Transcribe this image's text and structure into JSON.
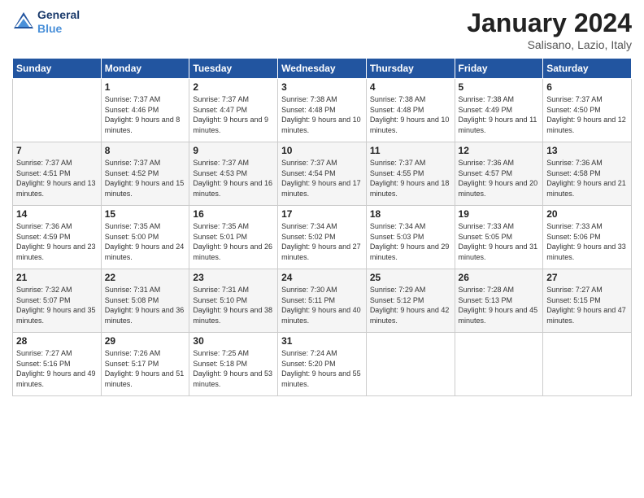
{
  "header": {
    "logo_line1": "General",
    "logo_line2": "Blue",
    "title": "January 2024",
    "subtitle": "Salisano, Lazio, Italy"
  },
  "days_of_week": [
    "Sunday",
    "Monday",
    "Tuesday",
    "Wednesday",
    "Thursday",
    "Friday",
    "Saturday"
  ],
  "weeks": [
    [
      {
        "day": "",
        "sunrise": "",
        "sunset": "",
        "daylight": ""
      },
      {
        "day": "1",
        "sunrise": "Sunrise: 7:37 AM",
        "sunset": "Sunset: 4:46 PM",
        "daylight": "Daylight: 9 hours and 8 minutes."
      },
      {
        "day": "2",
        "sunrise": "Sunrise: 7:37 AM",
        "sunset": "Sunset: 4:47 PM",
        "daylight": "Daylight: 9 hours and 9 minutes."
      },
      {
        "day": "3",
        "sunrise": "Sunrise: 7:38 AM",
        "sunset": "Sunset: 4:48 PM",
        "daylight": "Daylight: 9 hours and 10 minutes."
      },
      {
        "day": "4",
        "sunrise": "Sunrise: 7:38 AM",
        "sunset": "Sunset: 4:48 PM",
        "daylight": "Daylight: 9 hours and 10 minutes."
      },
      {
        "day": "5",
        "sunrise": "Sunrise: 7:38 AM",
        "sunset": "Sunset: 4:49 PM",
        "daylight": "Daylight: 9 hours and 11 minutes."
      },
      {
        "day": "6",
        "sunrise": "Sunrise: 7:37 AM",
        "sunset": "Sunset: 4:50 PM",
        "daylight": "Daylight: 9 hours and 12 minutes."
      }
    ],
    [
      {
        "day": "7",
        "sunrise": "Sunrise: 7:37 AM",
        "sunset": "Sunset: 4:51 PM",
        "daylight": "Daylight: 9 hours and 13 minutes."
      },
      {
        "day": "8",
        "sunrise": "Sunrise: 7:37 AM",
        "sunset": "Sunset: 4:52 PM",
        "daylight": "Daylight: 9 hours and 15 minutes."
      },
      {
        "day": "9",
        "sunrise": "Sunrise: 7:37 AM",
        "sunset": "Sunset: 4:53 PM",
        "daylight": "Daylight: 9 hours and 16 minutes."
      },
      {
        "day": "10",
        "sunrise": "Sunrise: 7:37 AM",
        "sunset": "Sunset: 4:54 PM",
        "daylight": "Daylight: 9 hours and 17 minutes."
      },
      {
        "day": "11",
        "sunrise": "Sunrise: 7:37 AM",
        "sunset": "Sunset: 4:55 PM",
        "daylight": "Daylight: 9 hours and 18 minutes."
      },
      {
        "day": "12",
        "sunrise": "Sunrise: 7:36 AM",
        "sunset": "Sunset: 4:57 PM",
        "daylight": "Daylight: 9 hours and 20 minutes."
      },
      {
        "day": "13",
        "sunrise": "Sunrise: 7:36 AM",
        "sunset": "Sunset: 4:58 PM",
        "daylight": "Daylight: 9 hours and 21 minutes."
      }
    ],
    [
      {
        "day": "14",
        "sunrise": "Sunrise: 7:36 AM",
        "sunset": "Sunset: 4:59 PM",
        "daylight": "Daylight: 9 hours and 23 minutes."
      },
      {
        "day": "15",
        "sunrise": "Sunrise: 7:35 AM",
        "sunset": "Sunset: 5:00 PM",
        "daylight": "Daylight: 9 hours and 24 minutes."
      },
      {
        "day": "16",
        "sunrise": "Sunrise: 7:35 AM",
        "sunset": "Sunset: 5:01 PM",
        "daylight": "Daylight: 9 hours and 26 minutes."
      },
      {
        "day": "17",
        "sunrise": "Sunrise: 7:34 AM",
        "sunset": "Sunset: 5:02 PM",
        "daylight": "Daylight: 9 hours and 27 minutes."
      },
      {
        "day": "18",
        "sunrise": "Sunrise: 7:34 AM",
        "sunset": "Sunset: 5:03 PM",
        "daylight": "Daylight: 9 hours and 29 minutes."
      },
      {
        "day": "19",
        "sunrise": "Sunrise: 7:33 AM",
        "sunset": "Sunset: 5:05 PM",
        "daylight": "Daylight: 9 hours and 31 minutes."
      },
      {
        "day": "20",
        "sunrise": "Sunrise: 7:33 AM",
        "sunset": "Sunset: 5:06 PM",
        "daylight": "Daylight: 9 hours and 33 minutes."
      }
    ],
    [
      {
        "day": "21",
        "sunrise": "Sunrise: 7:32 AM",
        "sunset": "Sunset: 5:07 PM",
        "daylight": "Daylight: 9 hours and 35 minutes."
      },
      {
        "day": "22",
        "sunrise": "Sunrise: 7:31 AM",
        "sunset": "Sunset: 5:08 PM",
        "daylight": "Daylight: 9 hours and 36 minutes."
      },
      {
        "day": "23",
        "sunrise": "Sunrise: 7:31 AM",
        "sunset": "Sunset: 5:10 PM",
        "daylight": "Daylight: 9 hours and 38 minutes."
      },
      {
        "day": "24",
        "sunrise": "Sunrise: 7:30 AM",
        "sunset": "Sunset: 5:11 PM",
        "daylight": "Daylight: 9 hours and 40 minutes."
      },
      {
        "day": "25",
        "sunrise": "Sunrise: 7:29 AM",
        "sunset": "Sunset: 5:12 PM",
        "daylight": "Daylight: 9 hours and 42 minutes."
      },
      {
        "day": "26",
        "sunrise": "Sunrise: 7:28 AM",
        "sunset": "Sunset: 5:13 PM",
        "daylight": "Daylight: 9 hours and 45 minutes."
      },
      {
        "day": "27",
        "sunrise": "Sunrise: 7:27 AM",
        "sunset": "Sunset: 5:15 PM",
        "daylight": "Daylight: 9 hours and 47 minutes."
      }
    ],
    [
      {
        "day": "28",
        "sunrise": "Sunrise: 7:27 AM",
        "sunset": "Sunset: 5:16 PM",
        "daylight": "Daylight: 9 hours and 49 minutes."
      },
      {
        "day": "29",
        "sunrise": "Sunrise: 7:26 AM",
        "sunset": "Sunset: 5:17 PM",
        "daylight": "Daylight: 9 hours and 51 minutes."
      },
      {
        "day": "30",
        "sunrise": "Sunrise: 7:25 AM",
        "sunset": "Sunset: 5:18 PM",
        "daylight": "Daylight: 9 hours and 53 minutes."
      },
      {
        "day": "31",
        "sunrise": "Sunrise: 7:24 AM",
        "sunset": "Sunset: 5:20 PM",
        "daylight": "Daylight: 9 hours and 55 minutes."
      },
      {
        "day": "",
        "sunrise": "",
        "sunset": "",
        "daylight": ""
      },
      {
        "day": "",
        "sunrise": "",
        "sunset": "",
        "daylight": ""
      },
      {
        "day": "",
        "sunrise": "",
        "sunset": "",
        "daylight": ""
      }
    ]
  ]
}
